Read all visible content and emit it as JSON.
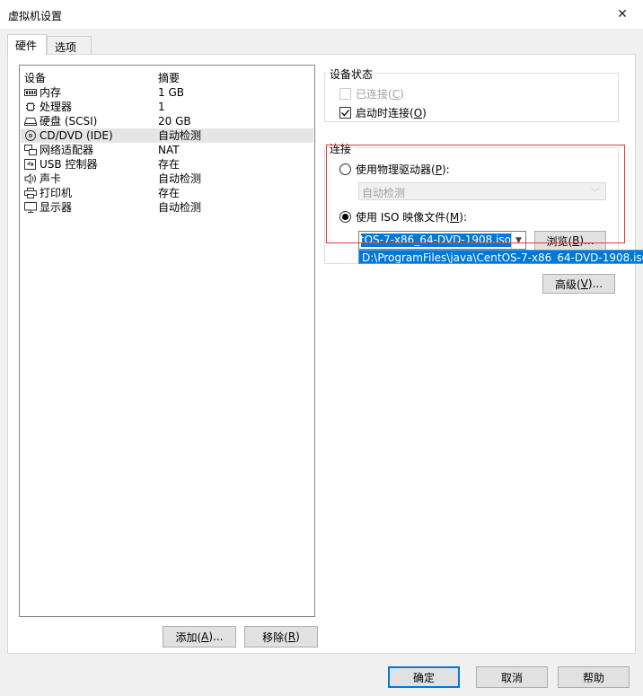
{
  "window": {
    "title": "虚拟机设置",
    "close_glyph": "✕"
  },
  "tabs": [
    {
      "label": "硬件",
      "active": true
    },
    {
      "label": "选项",
      "active": false
    }
  ],
  "device_list": {
    "columns": [
      "设备",
      "摘要"
    ],
    "rows": [
      {
        "icon": "memory-icon",
        "name": "内存",
        "summary": "1 GB",
        "selected": false
      },
      {
        "icon": "processor-icon",
        "name": "处理器",
        "summary": "1",
        "selected": false
      },
      {
        "icon": "hard-disk-icon",
        "name": "硬盘 (SCSI)",
        "summary": "20 GB",
        "selected": false
      },
      {
        "icon": "cd-dvd-icon",
        "name": "CD/DVD (IDE)",
        "summary": "自动检测",
        "selected": true
      },
      {
        "icon": "network-adapter-icon",
        "name": "网络适配器",
        "summary": "NAT",
        "selected": false
      },
      {
        "icon": "usb-controller-icon",
        "name": "USB 控制器",
        "summary": "存在",
        "selected": false
      },
      {
        "icon": "sound-card-icon",
        "name": "声卡",
        "summary": "自动检测",
        "selected": false
      },
      {
        "icon": "printer-icon",
        "name": "打印机",
        "summary": "存在",
        "selected": false
      },
      {
        "icon": "display-icon",
        "name": "显示器",
        "summary": "自动检测",
        "selected": false
      }
    ],
    "add_label": "添加(",
    "add_key": "A",
    "add_suffix": ")...",
    "remove_label": "移除(",
    "remove_key": "R",
    "remove_suffix": ")"
  },
  "device_status": {
    "legend": "设备状态",
    "connected": {
      "label": "已连接(",
      "key": "C",
      "suffix": ")",
      "checked": false,
      "disabled": true
    },
    "connect_at_power_on": {
      "label": "启动时连接(",
      "key": "O",
      "suffix": ")",
      "checked": true,
      "disabled": false
    }
  },
  "connection": {
    "legend": "连接",
    "physical_drive": {
      "label": "使用物理驱动器(",
      "key": "P",
      "suffix": "):",
      "selected": false
    },
    "physical_drive_value": "自动检测",
    "iso_image": {
      "label": "使用 ISO 映像文件(",
      "key": "M",
      "suffix": "):",
      "selected": true
    },
    "iso_value": "D:\\ProgramFiles\\java\\CentOS-7-x86_64-DVD-1908.iso",
    "iso_dropdown_item": "D:\\ProgramFiles\\java\\CentOS-7-x86_64-DVD-1908.iso",
    "browse_label": "浏览(",
    "browse_key": "B",
    "browse_suffix": ")...",
    "advanced_label": "高级(",
    "advanced_key": "V",
    "advanced_suffix": ")..."
  },
  "footer": {
    "ok": "确定",
    "cancel": "取消",
    "help": "帮助"
  },
  "colors": {
    "accent": "#0078d7",
    "highlight_box": "#e53935"
  }
}
